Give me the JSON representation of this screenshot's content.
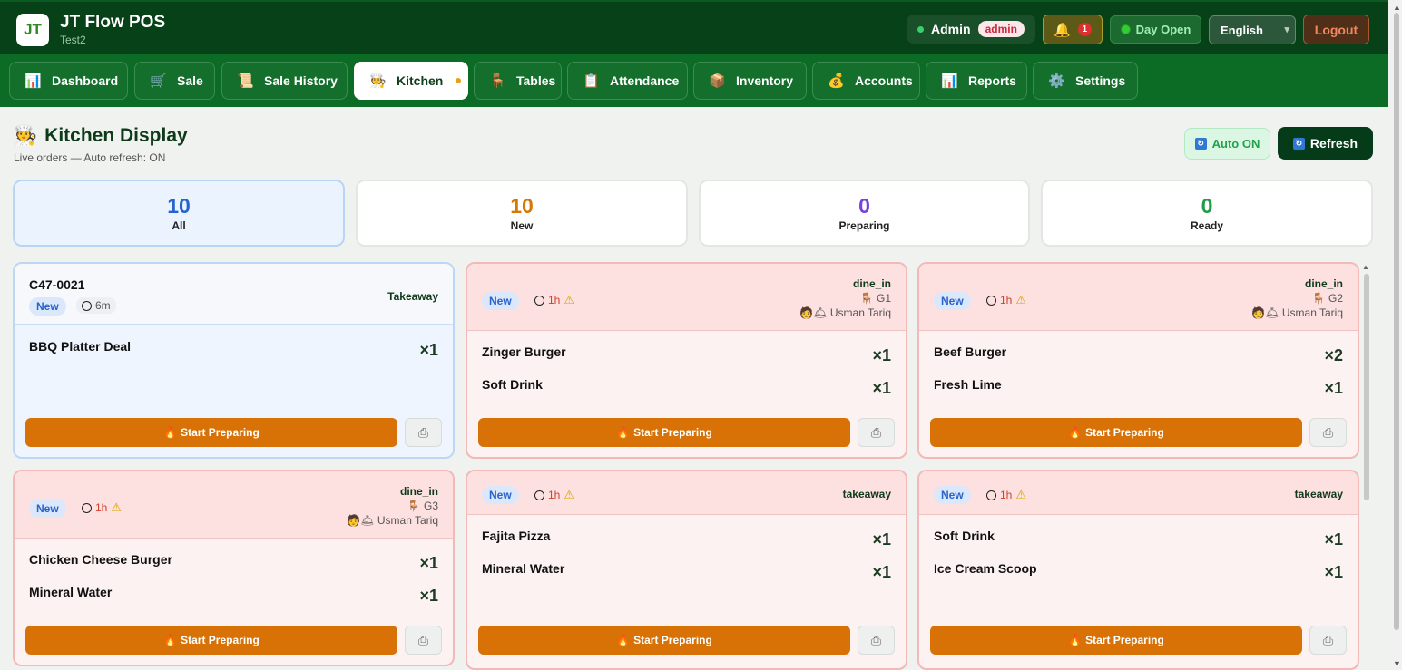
{
  "app": {
    "logo": "JT",
    "title": "JT Flow POS",
    "subtitle": "Test2"
  },
  "header": {
    "user": "Admin",
    "role_badge": "admin",
    "notification_count": "1",
    "day_status": "Day Open",
    "language": "English",
    "logout_label": "Logout"
  },
  "nav": {
    "tabs": [
      {
        "label": "Dashboard",
        "icon": "📊"
      },
      {
        "label": "Sale",
        "icon": "🛒"
      },
      {
        "label": "Sale History",
        "icon": "📜"
      },
      {
        "label": "Kitchen",
        "icon": "🧑‍🍳"
      },
      {
        "label": "Tables",
        "icon": "🪑"
      },
      {
        "label": "Attendance",
        "icon": "📋"
      },
      {
        "label": "Inventory",
        "icon": "📦"
      },
      {
        "label": "Accounts",
        "icon": "💰"
      },
      {
        "label": "Reports",
        "icon": "📊"
      },
      {
        "label": "Settings",
        "icon": "⚙️"
      }
    ],
    "active": "Kitchen"
  },
  "page": {
    "title": "Kitchen Display",
    "subtitle": "Live orders — Auto refresh: ON",
    "auto_label": "Auto ON",
    "refresh_label": "Refresh"
  },
  "stats": [
    {
      "value": "10",
      "label": "All",
      "color": "#2463d1"
    },
    {
      "value": "10",
      "label": "New",
      "color": "#d77707"
    },
    {
      "value": "0",
      "label": "Preparing",
      "color": "#7a3fe0"
    },
    {
      "value": "0",
      "label": "Ready",
      "color": "#1e9c48"
    }
  ],
  "orders": [
    {
      "order_no": "C47-0021",
      "status": "New",
      "elapsed": "6m",
      "type": "Takeaway",
      "table": "",
      "waiter": "",
      "items": [
        {
          "name": "BBQ Platter Deal",
          "qty": "×1"
        }
      ],
      "action": "Start Preparing"
    },
    {
      "order_no": "",
      "status": "New",
      "elapsed": "1h",
      "type": "dine_in",
      "table": "G1",
      "waiter": "Usman Tariq",
      "items": [
        {
          "name": "Zinger Burger",
          "qty": "×1"
        },
        {
          "name": "Soft Drink",
          "qty": "×1"
        }
      ],
      "action": "Start Preparing"
    },
    {
      "order_no": "",
      "status": "New",
      "elapsed": "1h",
      "type": "dine_in",
      "table": "G2",
      "waiter": "Usman Tariq",
      "items": [
        {
          "name": "Beef Burger",
          "qty": "×2"
        },
        {
          "name": "Fresh Lime",
          "qty": "×1"
        }
      ],
      "action": "Start Preparing"
    },
    {
      "order_no": "",
      "status": "New",
      "elapsed": "1h",
      "type": "dine_in",
      "table": "G3",
      "waiter": "Usman Tariq",
      "items": [
        {
          "name": "Chicken Cheese Burger",
          "qty": "×1"
        },
        {
          "name": "Mineral Water",
          "qty": "×1"
        }
      ],
      "action": "Start Preparing"
    },
    {
      "order_no": "",
      "status": "New",
      "elapsed": "1h",
      "type": "takeaway",
      "table": "",
      "waiter": "",
      "items": [
        {
          "name": "Fajita Pizza",
          "qty": "×1"
        },
        {
          "name": "Mineral Water",
          "qty": "×1"
        }
      ],
      "action": "Start Preparing"
    },
    {
      "order_no": "",
      "status": "New",
      "elapsed": "1h",
      "type": "takeaway",
      "table": "",
      "waiter": "",
      "items": [
        {
          "name": "Soft Drink",
          "qty": "×1"
        },
        {
          "name": "Ice Cream Scoop",
          "qty": "×1"
        }
      ],
      "action": "Start Preparing"
    }
  ]
}
